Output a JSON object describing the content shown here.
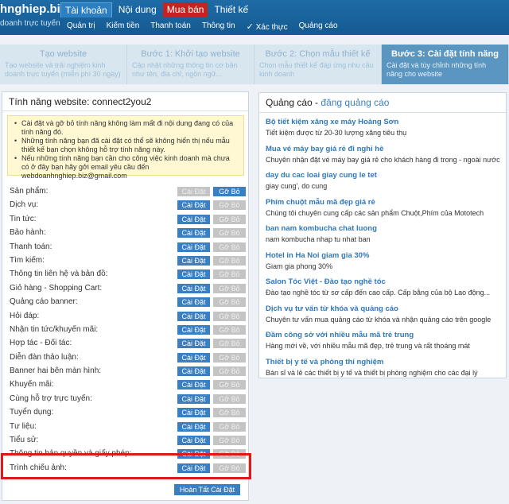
{
  "header": {
    "logo": "hnghiep.biz",
    "tagline": "doanh trực tuyến",
    "main_tabs": [
      {
        "label": "Tài khoản",
        "state": "active"
      },
      {
        "label": "Nội dung",
        "state": "normal"
      },
      {
        "label": "Mua bán",
        "state": "red"
      },
      {
        "label": "Thiết kế",
        "state": "normal"
      }
    ],
    "sub_nav": [
      "Quản trị",
      "Kiếm tiền",
      "Thanh toán",
      "Thông tin",
      "Xác thực",
      "Quảng cáo"
    ],
    "check_icon": "check-icon"
  },
  "steps": [
    {
      "title": "Tạo website",
      "desc": "Tạo website và trải nghiệm kinh doanh trực tuyến (miễn phí 30 ngày)"
    },
    {
      "title": "Bước 1: Khởi tạo website",
      "desc": "Cập nhật những thông tin cơ bản như tên, địa chỉ, ngôn ngữ..."
    },
    {
      "title": "Bước 2: Chọn mẫu thiết kế",
      "desc": "Chọn mẫu thiết kế đáp ứng nhu cầu kinh doanh"
    },
    {
      "title": "Bước 3: Cài đặt tính năng",
      "desc": "Cài đặt và tùy chỉnh những tính năng cho website",
      "current": true
    }
  ],
  "left": {
    "title": "Tính năng website: connect2you2",
    "notice": [
      "Cài đặt và gỡ bỏ tính năng không làm mất đi nội dung đang có của tính năng đó.",
      "Những tính năng bạn đã cài đặt có thể sẽ không hiển thị nếu mẫu thiết kế bạn chọn không hỗ trợ tính năng này.",
      "Nếu những tính năng bạn cần cho công việc kinh doanh mà chưa có ở đây bạn hãy gởi email yêu cầu đến webdoanhnghiep.biz@gmail.com"
    ],
    "install_label": "Cài Đặt",
    "remove_label": "Gỡ Bỏ",
    "features": [
      {
        "name": "Sản phẩm:",
        "installed": true
      },
      {
        "name": "Dịch vụ:",
        "installed": false
      },
      {
        "name": "Tin tức:",
        "installed": false
      },
      {
        "name": "Bảo hành:",
        "installed": false
      },
      {
        "name": "Thanh toán:",
        "installed": false
      },
      {
        "name": "Tìm kiếm:",
        "installed": false
      },
      {
        "name": "Thông tin liên hệ và bản đồ:",
        "installed": false
      },
      {
        "name": "Giỏ hàng - Shopping Cart:",
        "installed": false
      },
      {
        "name": "Quảng cáo banner:",
        "installed": false
      },
      {
        "name": "Hỏi đáp:",
        "installed": false
      },
      {
        "name": "Nhận tin tức/khuyến mãi:",
        "installed": false
      },
      {
        "name": "Hợp tác - Đối tác:",
        "installed": false
      },
      {
        "name": "Diễn đàn thảo luận:",
        "installed": false
      },
      {
        "name": "Banner hai bên màn hình:",
        "installed": false
      },
      {
        "name": "Khuyến mãi:",
        "installed": false
      },
      {
        "name": "Cùng hỗ trợ trực tuyến:",
        "installed": false
      },
      {
        "name": "Tuyển dụng:",
        "installed": false
      },
      {
        "name": "Tư liệu:",
        "installed": false
      },
      {
        "name": "Tiểu sử:",
        "installed": false
      },
      {
        "name": "Thông tin bản quyền và giấy phép:",
        "installed": false
      },
      {
        "name": "Trình chiếu ảnh:",
        "installed": false
      }
    ],
    "finish_label": "Hoàn Tất Cài Đặt"
  },
  "ads": {
    "title": "Quảng cáo",
    "sep": " - ",
    "link": "đăng quảng cáo",
    "items": [
      {
        "title": "Bộ tiết kiệm xăng xe máy Hoàng Sơn",
        "desc": "Tiết kiệm được từ 20-30 lượng xăng tiêu thụ"
      },
      {
        "title": "Mua vé máy bay giá rẻ đi nghỉ hè",
        "desc": "Chuyên nhận đặt vé máy bay giá rẻ cho khách hàng đi trong - ngoài nước"
      },
      {
        "title": "day du cac loai giay cung le tet",
        "desc": "giay cung', do cung"
      },
      {
        "title": "Phím chuột mẫu mã đẹp giá rẻ",
        "desc": "Chúng tôi chuyên cung cấp các sản phẩm Chuột,Phím của Mototech"
      },
      {
        "title": "ban nam kombucha chat luong",
        "desc": "nam kombucha nhap tu nhat ban"
      },
      {
        "title": "Hotel in Ha Noi giam gia 30%",
        "desc": "Giam gia phong 30%"
      },
      {
        "title": "Salon Tóc Việt - Đào tạo nghề tóc",
        "desc": "Đào tạo nghề tóc từ sơ cấp đến cao cấp. Cấp bằng của bộ Lao động..."
      },
      {
        "title": "Dịch vụ tư vấn từ khóa và quảng cáo",
        "desc": "Chuyên tư vấn mua quảng cáo từ khóa và nhận quảng cáo trên google"
      },
      {
        "title": "Đầm công sở với nhiều mẫu mã trẻ trung",
        "desc": "Hàng mới về, với nhiều mẫu mã đẹp, trẻ trung và rất thoáng mát"
      },
      {
        "title": "Thiết bị y tế và phòng thí nghiệm",
        "desc": "Bán sỉ và lẻ các thiết bị y tế và thiết bị phòng nghiệm cho các đại lý"
      }
    ]
  }
}
